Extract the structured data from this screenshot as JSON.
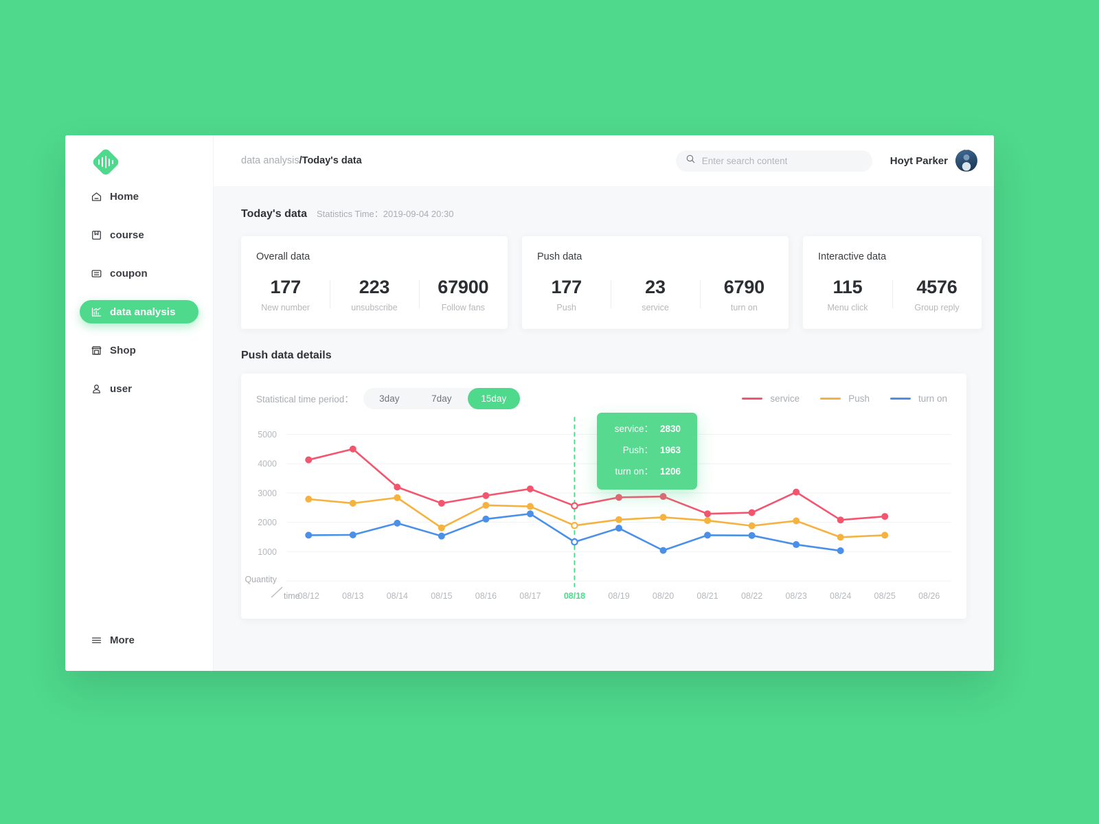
{
  "brand": {
    "logo_icon": "sound-wave-diamond-logo",
    "accent": "#4fd98d"
  },
  "sidebar": {
    "items": [
      {
        "label": "Home",
        "icon": "home-icon",
        "active": false
      },
      {
        "label": "course",
        "icon": "book-icon",
        "active": false
      },
      {
        "label": "coupon",
        "icon": "coupon-icon",
        "active": false
      },
      {
        "label": "data analysis",
        "icon": "bar-chart-icon",
        "active": true
      },
      {
        "label": "Shop",
        "icon": "shop-icon",
        "active": false
      },
      {
        "label": "user",
        "icon": "user-icon",
        "active": false
      }
    ],
    "more": {
      "label": "More",
      "icon": "hamburger-icon"
    }
  },
  "topbar": {
    "breadcrumb_parent": "data analysis",
    "breadcrumb_separator": "/",
    "breadcrumb_current": "Today's data",
    "search": {
      "placeholder": "Enter search content",
      "value": "",
      "icon": "search-icon"
    },
    "user_name": "Hoyt Parker",
    "avatar_icon": "avatar"
  },
  "today": {
    "title": "Today's data",
    "statistics_time_label": "Statistics Time：",
    "statistics_time_value": "2019-09-04  20:30",
    "cards": [
      {
        "title": "Overall data",
        "stats": [
          {
            "value": "177",
            "label": "New number"
          },
          {
            "value": "223",
            "label": "unsubscribe"
          },
          {
            "value": "67900",
            "label": "Follow fans"
          }
        ]
      },
      {
        "title": "Push data",
        "stats": [
          {
            "value": "177",
            "label": "Push"
          },
          {
            "value": "23",
            "label": "service"
          },
          {
            "value": "6790",
            "label": "turn on"
          }
        ]
      },
      {
        "title": "Interactive data",
        "stats": [
          {
            "value": "115",
            "label": "Menu click"
          },
          {
            "value": "4576",
            "label": "Group reply"
          }
        ]
      }
    ]
  },
  "push_details": {
    "title": "Push data details",
    "period_label": "Statistical time period：",
    "periods": [
      {
        "label": "3day",
        "active": false
      },
      {
        "label": "7day",
        "active": false
      },
      {
        "label": "15day",
        "active": true
      }
    ],
    "tooltip": {
      "rows": [
        {
          "key": "service：",
          "value": "2830"
        },
        {
          "key": "Push：",
          "value": "1963"
        },
        {
          "key": "turn on：",
          "value": "1206"
        }
      ]
    }
  },
  "chart_data": {
    "type": "line",
    "title": "Push data details",
    "xlabel": "time",
    "ylabel": "Quantity",
    "ylim": [
      0,
      5200
    ],
    "yticks": [
      1000,
      2000,
      3000,
      4000,
      5000
    ],
    "grid": true,
    "legend_position": "top-right",
    "highlight_category": "08/18",
    "categories": [
      "08/12",
      "08/13",
      "08/14",
      "08/15",
      "08/16",
      "08/17",
      "08/18",
      "08/19",
      "08/20",
      "08/21",
      "08/22",
      "08/23",
      "08/24",
      "08/25",
      "08/26"
    ],
    "series": [
      {
        "name": "service",
        "color": "#f4556e",
        "values": [
          4130,
          4500,
          3200,
          2650,
          2910,
          3140,
          2560,
          2850,
          2880,
          2290,
          2330,
          3030,
          2080,
          2200,
          null
        ]
      },
      {
        "name": "Push",
        "color": "#f6b23f",
        "values": [
          2790,
          2650,
          2840,
          1810,
          2580,
          2540,
          1890,
          2090,
          2170,
          2060,
          1880,
          2050,
          1490,
          1560,
          null
        ]
      },
      {
        "name": "turn on",
        "color": "#4a90e8",
        "values": [
          1560,
          1570,
          1970,
          1530,
          2110,
          2290,
          1330,
          1800,
          1040,
          1560,
          1550,
          1240,
          1030,
          null,
          null
        ]
      }
    ],
    "hover_values": {
      "service": 2830,
      "Push": 1963,
      "turn on": 1206
    }
  }
}
